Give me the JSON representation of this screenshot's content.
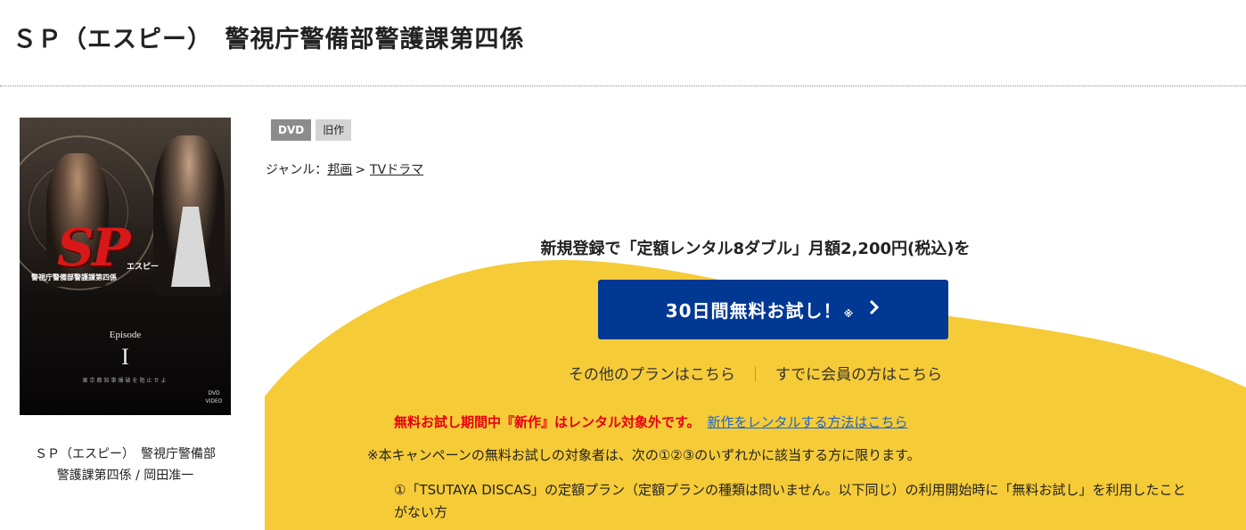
{
  "page_title": "ＳＰ（エスピー）　警視庁警備部警護課第四係",
  "jacket": {
    "logo": "SP",
    "logo_kana": "エスピー",
    "subtitle": "警視庁警備部警護課第四係",
    "episode_label": "Episode",
    "episode_num": "I",
    "tagline": "東京都知事爆破を阻止せよ",
    "dvd_mark": "DVD VIDEO"
  },
  "caption": {
    "line1": "ＳＰ（エスピー）　警視庁警備部",
    "line2": "警護課第四係 / 岡田准一"
  },
  "badges": {
    "format": "DVD",
    "status": "旧作"
  },
  "genre": {
    "label": "ジャンル：",
    "item1": "邦画",
    "sep": ">",
    "item2": "TVドラマ"
  },
  "campaign": {
    "headline": "新規登録で「定額レンタル8ダブル」月額2,200円(税込)を",
    "cta_label": "30日間無料お試し！",
    "cta_mark": "※",
    "other_plans": "その他のプランはこちら",
    "separator": "｜",
    "members": "すでに会員の方はこちら",
    "notice_red": "無料お試し期間中『新作』はレンタル対象外です。",
    "notice_link": "新作をレンタルする方法はこちら",
    "note1": "※本キャンペーンの無料お試しの対象者は、次の①②③のいずれかに該当する方に限ります。",
    "note2": "①「TSUTAYA DISCAS」の定額プラン（定額プランの種類は問いません。以下同じ）の利用開始時に「無料お試し」を利用したことがない方"
  },
  "colors": {
    "accent_yellow": "#f6cb38",
    "cta_blue": "#003893",
    "notice_red": "#e60012",
    "link_blue": "#1f65c8"
  }
}
